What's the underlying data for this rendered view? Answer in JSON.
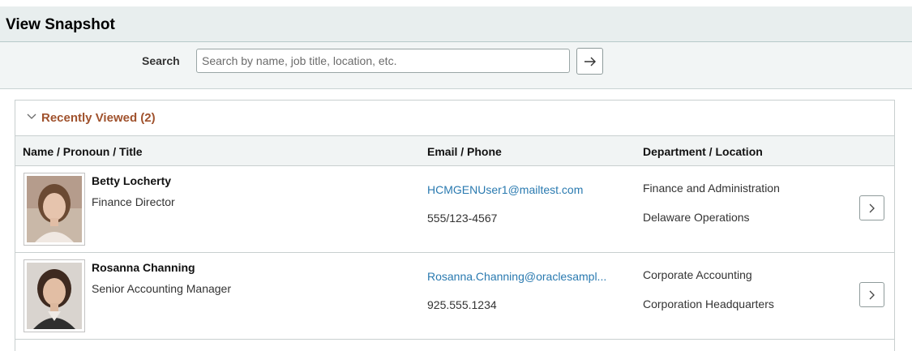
{
  "page": {
    "title": "View Snapshot"
  },
  "search": {
    "label": "Search",
    "placeholder": "Search by name, job title, location, etc.",
    "value": ""
  },
  "recently_viewed": {
    "title": "Recently Viewed (2)",
    "columns": [
      "Name / Pronoun / Title",
      "Email / Phone",
      "Department / Location"
    ],
    "rows": [
      {
        "name": "Betty Locherty",
        "title": "Finance Director",
        "email": "HCMGENUser1@mailtest.com",
        "phone": "555/123-4567",
        "department": "Finance and Administration",
        "location": "Delaware Operations"
      },
      {
        "name": "Rosanna Channing",
        "title": "Senior Accounting Manager",
        "email": "Rosanna.Channing@oraclesampl...",
        "phone": "925.555.1234",
        "department": "Corporate Accounting",
        "location": "Corporation Headquarters"
      }
    ]
  },
  "colors": {
    "header_bg": "#e8eeee",
    "section_title": "#a0522d",
    "link": "#2a7ab0"
  },
  "icons": {
    "go": "arrow-right-icon",
    "collapse": "chevron-down-icon",
    "row_action": "chevron-right-icon"
  }
}
